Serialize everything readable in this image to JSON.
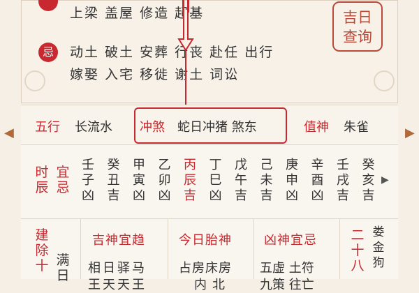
{
  "top_section": {
    "yi_items_line": "上梁 盖屋 修造 起基",
    "ji_badge": "忌",
    "ji_items_line1": "动土 破土 安葬 行丧 赴任 出行",
    "ji_items_line2": "嫁娶 入宅 移徙 谢土 词讼",
    "query_button": [
      "吉日",
      "查询"
    ]
  },
  "info_band": {
    "wuxing_label": "五行",
    "wuxing_value": "长流水",
    "chongsha_label": "冲煞",
    "chongsha_value": "蛇日冲猪 煞东",
    "zhishen_label": "值神",
    "zhishen_value": "朱雀"
  },
  "hours": {
    "label_top": [
      "时",
      "辰"
    ],
    "label_yi": [
      "宜",
      "忌"
    ],
    "columns": [
      {
        "stem": "壬",
        "branch": "子",
        "luck": "凶",
        "red": false
      },
      {
        "stem": "癸",
        "branch": "丑",
        "luck": "吉",
        "red": false
      },
      {
        "stem": "甲",
        "branch": "寅",
        "luck": "凶",
        "red": false
      },
      {
        "stem": "乙",
        "branch": "卯",
        "luck": "凶",
        "red": false
      },
      {
        "stem": "丙",
        "branch": "辰",
        "luck": "吉",
        "red": true
      },
      {
        "stem": "丁",
        "branch": "巳",
        "luck": "凶",
        "red": false
      },
      {
        "stem": "戊",
        "branch": "午",
        "luck": "吉",
        "red": false
      },
      {
        "stem": "己",
        "branch": "未",
        "luck": "吉",
        "red": false
      },
      {
        "stem": "庚",
        "branch": "申",
        "luck": "凶",
        "red": false
      },
      {
        "stem": "辛",
        "branch": "酉",
        "luck": "凶",
        "red": false
      },
      {
        "stem": "壬",
        "branch": "戌",
        "luck": "吉",
        "red": false
      },
      {
        "stem": "癸",
        "branch": "亥",
        "luck": "吉",
        "red": false
      }
    ]
  },
  "bottom": {
    "jianchu": [
      "建",
      "除",
      "十"
    ],
    "man_ri": [
      "满",
      "日"
    ],
    "jishen_header": "吉神宜趋",
    "jishen_row1": "相日驿马",
    "jishen_row2": "王天天王",
    "taishen_header": "今日胎神",
    "taishen_row1": "占房床房",
    "taishen_row2": "内北",
    "xiongshen_header": "凶神宜忌",
    "xiongshen_row1": "五虚 土符",
    "xiongshen_row2": "九策 往亡",
    "xiu_col": [
      "二",
      "十",
      "八"
    ],
    "xiu_detail": [
      "娄",
      "金",
      "狗"
    ]
  },
  "colors": {
    "accent_red": "#c8282f",
    "background": "#f5efe6"
  }
}
